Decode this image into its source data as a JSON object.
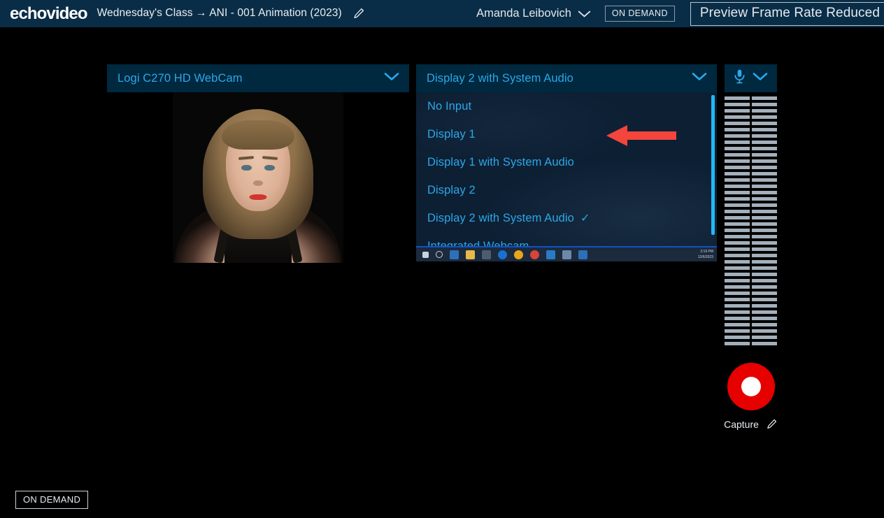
{
  "header": {
    "logo": "echovideo",
    "breadcrumb": "Wednesday's Class → ANI - 001 Animation (2023)",
    "edit_icon": "pencil-icon",
    "user_name": "Amanda Leibovich",
    "user_chevron_icon": "chevron-down-icon",
    "on_demand_badge": "ON DEMAND",
    "frame_rate_notice": "Preview Frame Rate Reduced",
    "bar_color": "#0a2d47"
  },
  "camera_panel": {
    "selected_source": "Logi C270 HD WebCam",
    "chevron_icon": "chevron-down-icon",
    "preview_alt": "webcam-preview"
  },
  "display_panel": {
    "selected_source": "Display 2 with System Audio",
    "chevron_icon": "chevron-down-icon",
    "dropdown_open": true,
    "options": [
      {
        "label": "No Input",
        "selected": false
      },
      {
        "label": "Display 1",
        "selected": false
      },
      {
        "label": "Display 1 with System Audio",
        "selected": false
      },
      {
        "label": "Display 2",
        "selected": false
      },
      {
        "label": "Display 2 with System Audio",
        "selected": true
      },
      {
        "label": "Integrated Webcam",
        "selected": false
      }
    ],
    "check_glyph": "✓",
    "annotation": "red-left-arrow pointing at Display 2 with System Audio",
    "taskbar": {
      "clock_time": "2:19 PM",
      "clock_date": "12/6/2023",
      "icons": [
        "start-icon",
        "search-icon",
        "task-view-icon",
        "file-explorer-icon",
        "store-icon",
        "edge-icon",
        "chrome-icon",
        "photos-icon",
        "mail-icon",
        "active-app-icon",
        "s-app-icon"
      ]
    },
    "scrollbar_color": "#22b7f7"
  },
  "audio_panel": {
    "mic_icon": "microphone-icon",
    "chevron_icon": "chevron-down-icon",
    "meter_segment_rows": 40,
    "meter_segment_color": "#a3b0bb"
  },
  "capture": {
    "button_icon": "record-button",
    "button_color": "#e60000",
    "label": "Capture",
    "edit_icon": "pencil-icon"
  },
  "footer": {
    "on_demand_badge": "ON DEMAND"
  }
}
